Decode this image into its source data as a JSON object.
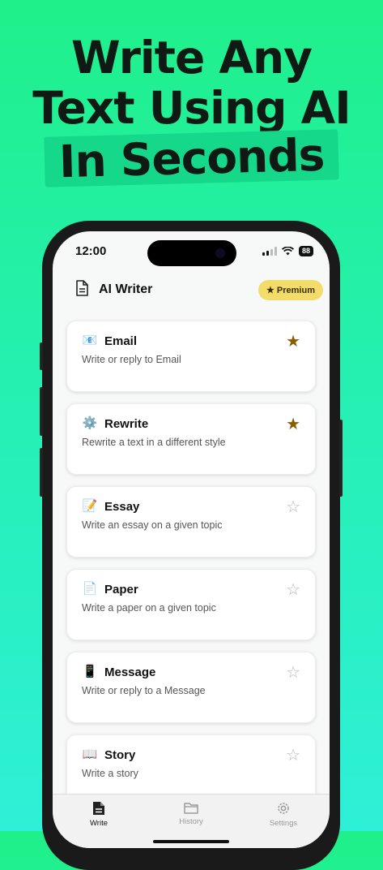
{
  "headline": {
    "line1": "Write Any",
    "line2": "Text Using AI",
    "line3": "In Seconds"
  },
  "status": {
    "time": "12:00",
    "battery": "88"
  },
  "nav": {
    "title": "AI Writer",
    "premium_label": "★ Premium"
  },
  "items": [
    {
      "emoji": "📧",
      "title": "Email",
      "desc": "Write or reply to Email",
      "starred": true,
      "star": "★"
    },
    {
      "emoji": "⚙️",
      "title": "Rewrite",
      "desc": "Rewrite a text in a different style",
      "starred": true,
      "star": "★"
    },
    {
      "emoji": "📝",
      "title": "Essay",
      "desc": "Write an essay on a given topic",
      "starred": false,
      "star": "☆"
    },
    {
      "emoji": "📄",
      "title": "Paper",
      "desc": "Write a paper on a given topic",
      "starred": false,
      "star": "☆"
    },
    {
      "emoji": "📱",
      "title": "Message",
      "desc": "Write or reply to a Message",
      "starred": false,
      "star": "☆"
    },
    {
      "emoji": "📖",
      "title": "Story",
      "desc": "Write a story",
      "starred": false,
      "star": "☆"
    }
  ],
  "tabs": [
    {
      "label": "Write",
      "icon": "document-icon",
      "active": true
    },
    {
      "label": "History",
      "icon": "folder-icon",
      "active": false
    },
    {
      "label": "Settings",
      "icon": "gear-icon",
      "active": false
    }
  ],
  "colors": {
    "accent": "#1ff08a",
    "premium": "#f4dc6b",
    "star_on": "#8a5c00"
  }
}
